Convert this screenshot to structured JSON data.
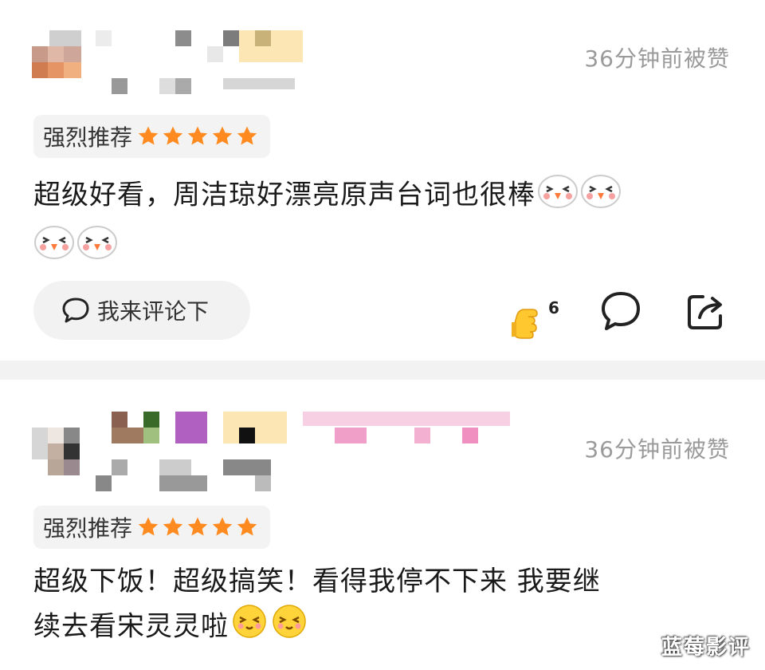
{
  "comments": [
    {
      "time": "36分钟前被赞",
      "rating_label": "强烈推荐",
      "stars": 5,
      "line1": "超级好看，周洁琼好漂亮原声台词也很棒",
      "line2": "",
      "emoji_count_line1": 2,
      "emoji_count_line2": 2,
      "emoji": "chick-face-emoji",
      "reply_label": "我来评论下",
      "like_count": "6"
    },
    {
      "time": "36分钟前被赞",
      "rating_label": "强烈推荐",
      "stars": 5,
      "line1": "超级下饭！超级搞笑！看得我停不下来 我要继",
      "line2": "续去看宋灵灵啦",
      "emoji": "blush-smile-emoji"
    }
  ],
  "watermark": "蓝莓影评",
  "colors": {
    "star": "#ff8a1f",
    "accent_pink": "#f7b8d6",
    "muted": "#9a9a9a"
  }
}
